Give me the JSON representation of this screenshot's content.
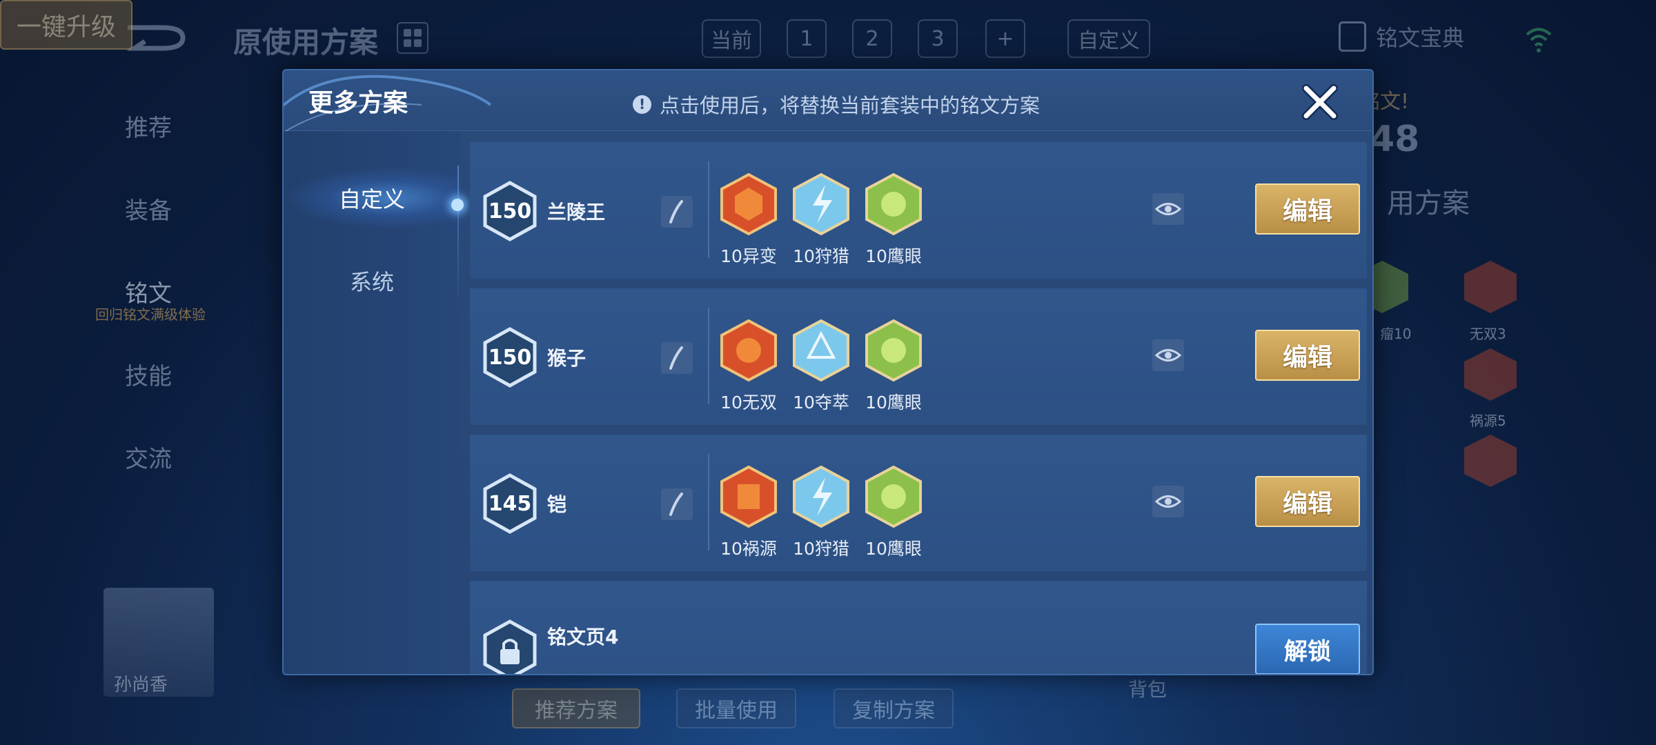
{
  "background": {
    "title": "原使用方案",
    "tabs": [
      "当前",
      "1",
      "2",
      "3",
      "+",
      "自定义"
    ],
    "guide": "铭文宝典",
    "sidebar": [
      "推荐",
      "装备",
      "铭文",
      "技能",
      "交流"
    ],
    "sidebar_sub": "回归铭文满级体验",
    "avatar_name": "孙尚香",
    "bottom_buttons": [
      "推荐方案",
      "批量使用",
      "复制方案"
    ],
    "bag": "背包",
    "upgrade": "一键升级",
    "right_title": "用方案",
    "right_num": "48",
    "right_banner": "铭文!",
    "right_labels": [
      "瘤10",
      "无双3",
      "祸源5"
    ]
  },
  "modal": {
    "title": "更多方案",
    "hint": "点击使用后，将替换当前套装中的铭文方案",
    "close_icon": "close-icon",
    "tabs": [
      "自定义",
      "系统"
    ],
    "rows": [
      {
        "level": "150",
        "name": "兰陵王",
        "action": "编辑",
        "runes": [
          {
            "label": "10异变",
            "color": "red"
          },
          {
            "label": "10狩猎",
            "color": "blue"
          },
          {
            "label": "10鹰眼",
            "color": "green"
          }
        ]
      },
      {
        "level": "150",
        "name": "猴子",
        "action": "编辑",
        "runes": [
          {
            "label": "10无双",
            "color": "red"
          },
          {
            "label": "10夺萃",
            "color": "blue"
          },
          {
            "label": "10鹰眼",
            "color": "green"
          }
        ]
      },
      {
        "level": "145",
        "name": "铠",
        "action": "编辑",
        "runes": [
          {
            "label": "10祸源",
            "color": "red"
          },
          {
            "label": "10狩猎",
            "color": "blue"
          },
          {
            "label": "10鹰眼",
            "color": "green"
          }
        ]
      },
      {
        "name": "铭文页4",
        "action": "解锁",
        "locked": true
      }
    ]
  },
  "colors": {
    "accent_gold": "#d9b468",
    "accent_blue": "#3d86d6",
    "rune_red": "#d8502a",
    "rune_blue": "#7cc8ec",
    "rune_green": "#8cc04a"
  }
}
